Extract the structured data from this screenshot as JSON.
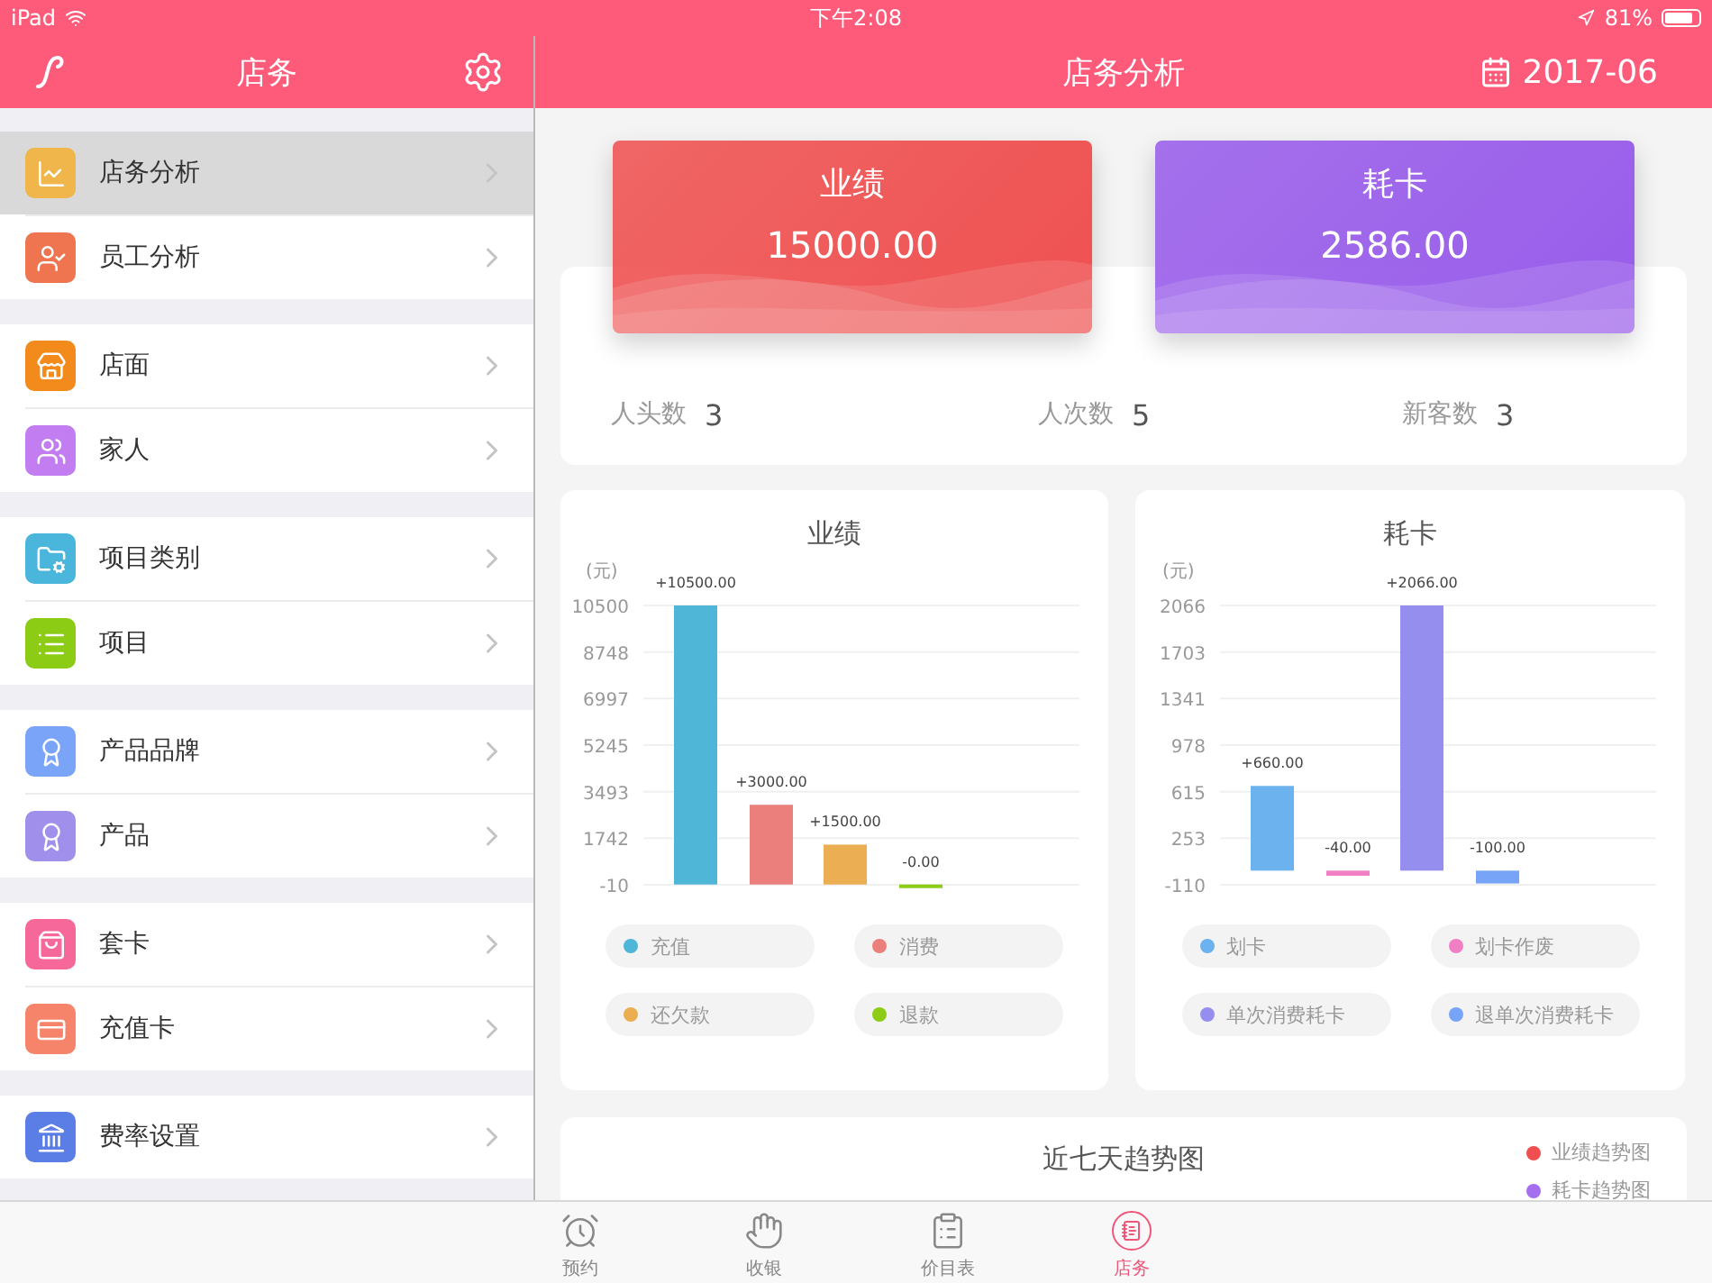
{
  "status_bar": {
    "device": "iPad",
    "time": "下午2:08",
    "battery": "81%"
  },
  "sidebar": {
    "title": "店务",
    "groups": [
      {
        "items": [
          {
            "label": "店务分析",
            "color": "#f0b64b",
            "selected": true
          },
          {
            "label": "员工分析",
            "color": "#ef7550",
            "selected": false
          }
        ]
      },
      {
        "items": [
          {
            "label": "店面",
            "color": "#f28a1c",
            "selected": false
          },
          {
            "label": "家人",
            "color": "#c27df0",
            "selected": false
          }
        ]
      },
      {
        "items": [
          {
            "label": "项目类别",
            "color": "#4ab6dc",
            "selected": false
          },
          {
            "label": "项目",
            "color": "#8ccc14",
            "selected": false
          }
        ]
      },
      {
        "items": [
          {
            "label": "产品品牌",
            "color": "#7aa4f8",
            "selected": false
          },
          {
            "label": "产品",
            "color": "#a090ec",
            "selected": false
          }
        ]
      },
      {
        "items": [
          {
            "label": "套卡",
            "color": "#f7689a",
            "selected": false
          },
          {
            "label": "充值卡",
            "color": "#f6846a",
            "selected": false
          }
        ]
      },
      {
        "items": [
          {
            "label": "费率设置",
            "color": "#5b7de6",
            "selected": false
          }
        ]
      }
    ]
  },
  "header": {
    "title": "店务分析",
    "date": "2017-06"
  },
  "summary_cards": [
    {
      "title": "业绩",
      "value": "15000.00",
      "color": "#ef5050"
    },
    {
      "title": "耗卡",
      "value": "2586.00",
      "color": "#985cea"
    }
  ],
  "stats": [
    {
      "label": "人头数",
      "value": "3"
    },
    {
      "label": "人次数",
      "value": "5"
    },
    {
      "label": "新客数",
      "value": "3"
    }
  ],
  "charts": [
    {
      "title": "业绩",
      "chart_data": {
        "type": "bar",
        "ylabel": "(元)",
        "ylim": [
          -10,
          10500
        ],
        "yticks": [
          -10,
          1742,
          3493,
          5245,
          6997,
          8748,
          10500
        ],
        "grid": true,
        "legend": "bottom",
        "series": [
          {
            "name": "充值",
            "color": "#4fb6d8",
            "values": [
              10500
            ]
          },
          {
            "name": "消费",
            "color": "#ea7f7c",
            "values": [
              3000
            ]
          },
          {
            "name": "还欠款",
            "color": "#ebae53",
            "values": [
              1500
            ]
          },
          {
            "name": "退款",
            "color": "#8ccc14",
            "values": [
              0
            ]
          }
        ],
        "value_labels": [
          "+10500.00",
          "+3000.00",
          "+1500.00",
          "-0.00"
        ]
      }
    },
    {
      "title": "耗卡",
      "chart_data": {
        "type": "bar",
        "ylabel": "(元)",
        "ylim": [
          -110,
          2066
        ],
        "yticks": [
          -110,
          253,
          615,
          978,
          1341,
          1703,
          2066
        ],
        "grid": true,
        "legend": "bottom",
        "series": [
          {
            "name": "划卡",
            "color": "#6cb2ee",
            "values": [
              660
            ]
          },
          {
            "name": "划卡作废",
            "color": "#f07fc4",
            "values": [
              -40
            ]
          },
          {
            "name": "单次消费耗卡",
            "color": "#968eee",
            "values": [
              2066
            ]
          },
          {
            "name": "退单次消费耗卡",
            "color": "#78a4f8",
            "values": [
              -100
            ]
          }
        ],
        "value_labels": [
          "+660.00",
          "-40.00",
          "+2066.00",
          "-100.00"
        ]
      }
    }
  ],
  "trend": {
    "title": "近七天趋势图",
    "legend": [
      {
        "label": "业绩趋势图",
        "color": "#ef4f4f"
      },
      {
        "label": "耗卡趋势图",
        "color": "#a66ef0"
      }
    ]
  },
  "tab_bar": [
    {
      "label": "预约",
      "selected": false
    },
    {
      "label": "收银",
      "selected": false
    },
    {
      "label": "价目表",
      "selected": false
    },
    {
      "label": "店务",
      "selected": true
    }
  ]
}
